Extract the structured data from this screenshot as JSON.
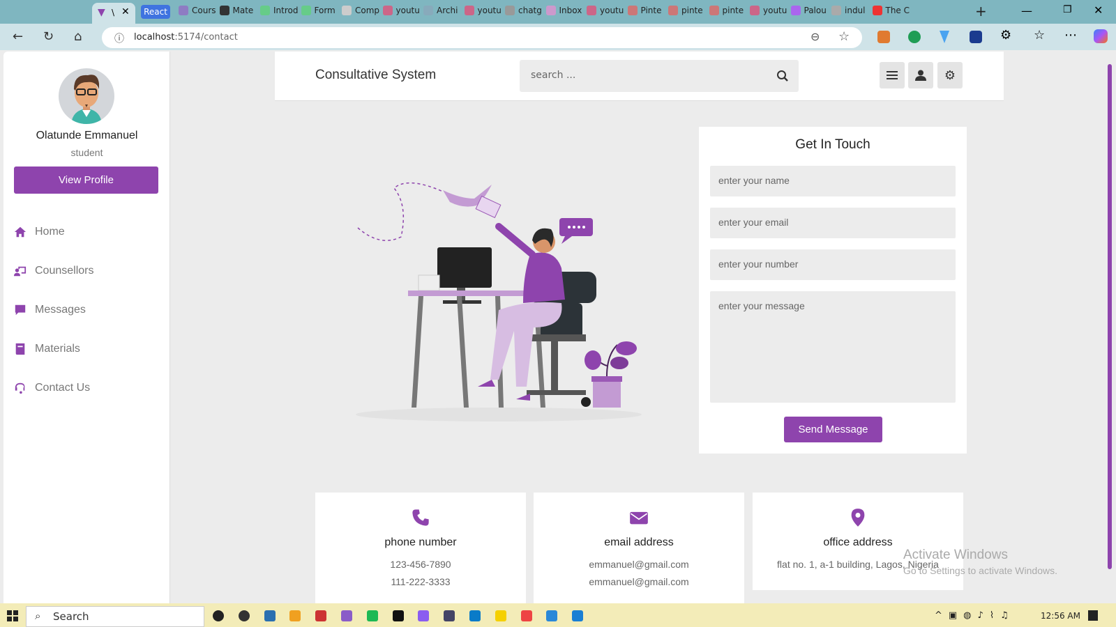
{
  "browser": {
    "tabs": [
      "React",
      "Cours",
      "Mate",
      "Introd",
      "Form",
      "Comp",
      "youtu",
      "Archi",
      "youtu",
      "chatg",
      "Inbox",
      "youtu",
      "Pinte",
      "pinte",
      "pinte",
      "youtu",
      "Palou",
      "indul",
      "The C"
    ],
    "active_tab": "\\",
    "url_host": "localhost",
    "url_path": ":5174/contact"
  },
  "app": {
    "title": "Consultative System",
    "search_placeholder": "search ...",
    "accent": "#8e44ad"
  },
  "sidebar": {
    "user_name": "Olatunde Emmanuel",
    "role": "student",
    "view_profile": "View Profile",
    "items": [
      {
        "label": "Home",
        "icon": "home-icon"
      },
      {
        "label": "Counsellors",
        "icon": "chalkboard-teacher-icon"
      },
      {
        "label": "Messages",
        "icon": "message-icon"
      },
      {
        "label": "Materials",
        "icon": "book-icon"
      },
      {
        "label": "Contact Us",
        "icon": "headset-icon"
      }
    ]
  },
  "form": {
    "title": "Get In Touch",
    "name_placeholder": "enter your name",
    "email_placeholder": "enter your email",
    "number_placeholder": "enter your number",
    "message_placeholder": "enter your message",
    "submit": "Send Message"
  },
  "cards": [
    {
      "title": "phone number",
      "lines": [
        "123-456-7890",
        "111-222-3333"
      ],
      "icon": "phone-icon"
    },
    {
      "title": "email address",
      "lines": [
        "emmanuel@gmail.com",
        "emmanuel@gmail.com"
      ],
      "icon": "envelope-icon"
    },
    {
      "title": "office address",
      "lines": [
        "flat no. 1, a-1 building, Lagos, Nigeria"
      ],
      "icon": "map-marker-icon"
    }
  ],
  "watermark": {
    "line1": "Activate Windows",
    "line2": "Go to Settings to activate Windows."
  },
  "taskbar": {
    "search": "Search",
    "time": "12:56 AM"
  }
}
